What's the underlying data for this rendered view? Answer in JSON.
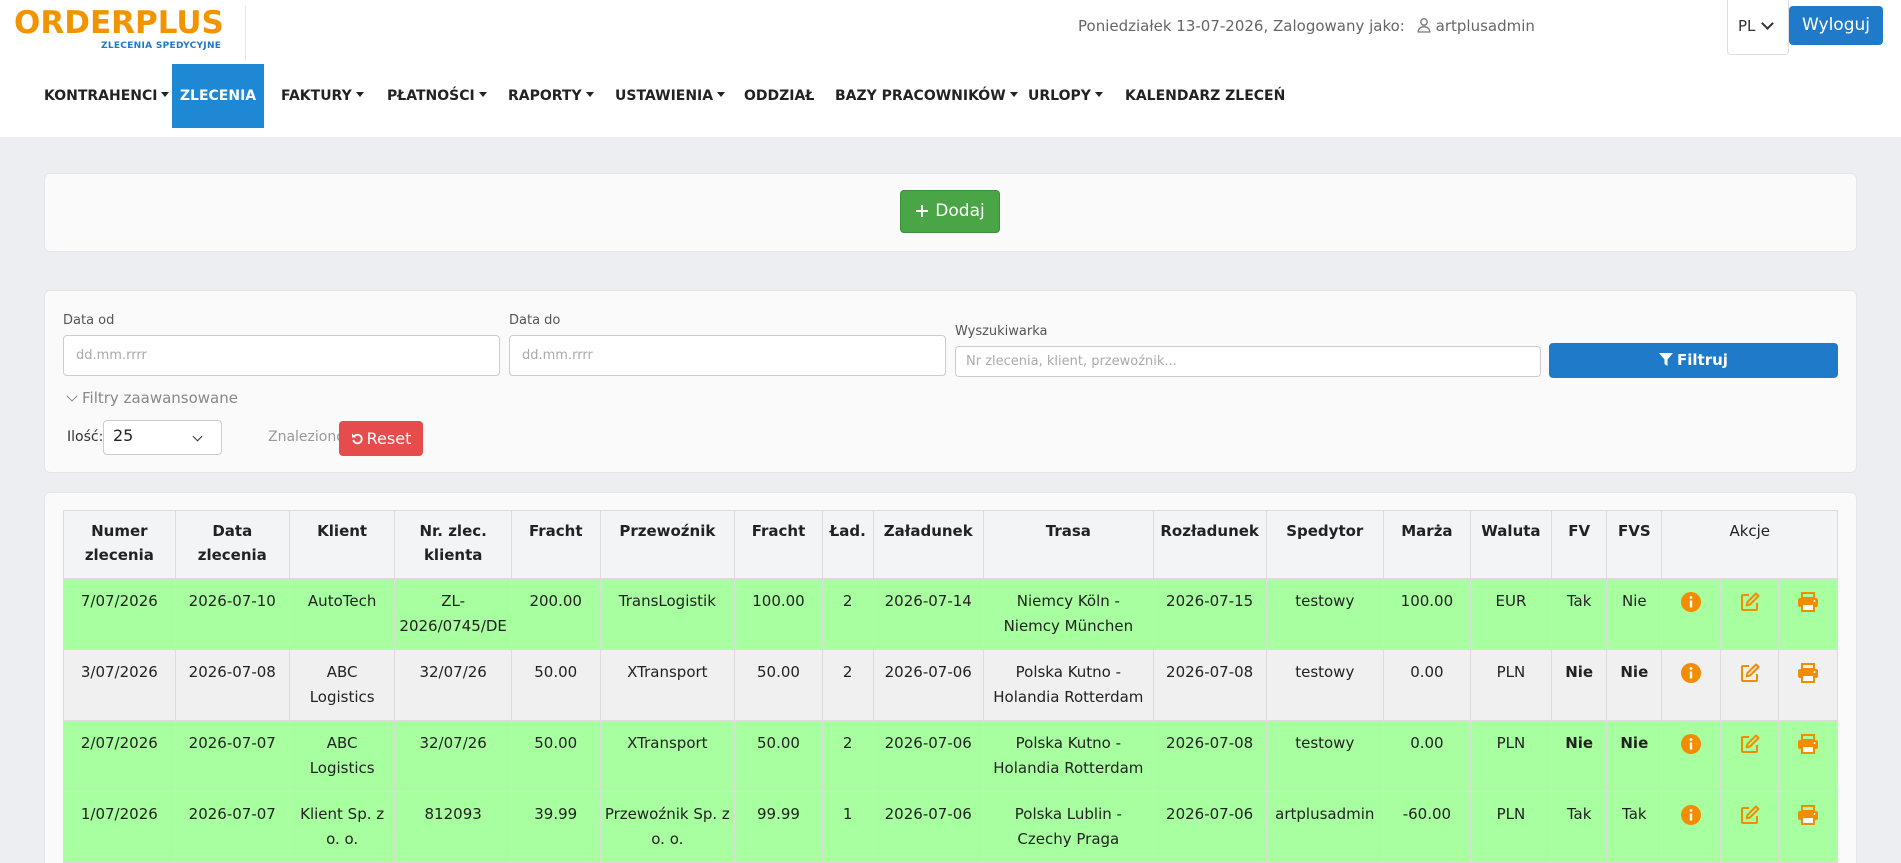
{
  "header": {
    "logo_main": "ORDERPLUS",
    "logo_sub": "ZLECENIA SPEDYCYJNE",
    "date_text": "Poniedziałek 13-07-2026, Zalogowany jako:",
    "username": "artplusadmin",
    "language": "PL",
    "logout_label": "Wyloguj",
    "colors": {
      "logo": "#f29400",
      "primary": "#1f7bc9"
    }
  },
  "nav": {
    "items": [
      {
        "label": "KONTRAHENCI",
        "dropdown": true
      },
      {
        "label": "ZLECENIA",
        "dropdown": false,
        "active": true
      },
      {
        "label": "FAKTURY",
        "dropdown": true
      },
      {
        "label": "PŁATNOŚCI",
        "dropdown": true
      },
      {
        "label": "RAPORTY",
        "dropdown": true
      },
      {
        "label": "USTAWIENIA",
        "dropdown": true
      },
      {
        "label": "ODDZIAŁ",
        "dropdown": false
      },
      {
        "label": "BAZY PRACOWNIKÓW",
        "dropdown": true
      },
      {
        "label": "URLOPY",
        "dropdown": true
      },
      {
        "label": "KALENDARZ ZLECEŃ",
        "dropdown": false
      }
    ]
  },
  "add_panel": {
    "add_label": "Dodaj"
  },
  "filters": {
    "date_from_label": "Data od",
    "date_from_placeholder": "dd.mm.rrrr",
    "date_to_label": "Data do",
    "date_to_placeholder": "dd.mm.rrrr",
    "search_label": "Wyszukiwarka",
    "search_placeholder": "Nr zlecenia, klient, przewoźnik...",
    "filter_label": "Filtruj",
    "advanced_label": "Filtry zaawansowane",
    "qty_label": "Ilość:",
    "qty_value": "25",
    "found_text": "Znaleziono: 4",
    "reset_label": "Reset"
  },
  "table": {
    "headers": [
      "Numer zlecenia",
      "Data zlecenia",
      "Klient",
      "Nr. zlec. klienta",
      "Fracht",
      "Przewoźnik",
      "Fracht",
      "Ład.",
      "Załadunek",
      "Trasa",
      "Rozładunek",
      "Spedytor",
      "Marża",
      "Waluta",
      "FV",
      "FVS",
      "Akcje"
    ],
    "rows": [
      {
        "style": "green",
        "numer": "7/07/2026",
        "data": "2026-07-10",
        "klient": "AutoTech",
        "nr_klienta": "ZL-2026/0745/DE",
        "fracht1": "200.00",
        "przewoznik": "TransLogistik",
        "fracht2": "100.00",
        "lad": "2",
        "zaladunek": "2026-07-14",
        "trasa": "Niemcy Köln - Niemcy München",
        "rozladunek": "2026-07-15",
        "spedytor": "testowy",
        "marza": "100.00",
        "waluta": "EUR",
        "fv": "Tak",
        "fvs": "Nie",
        "fv_style": "tak",
        "fvs_style": "plain"
      },
      {
        "style": "gray",
        "numer": "3/07/2026",
        "data": "2026-07-08",
        "klient": "ABC Logistics",
        "nr_klienta": "32/07/26",
        "fracht1": "50.00",
        "przewoznik": "XTransport",
        "fracht2": "50.00",
        "lad": "2",
        "zaladunek": "2026-07-06",
        "trasa": "Polska Kutno - Holandia Rotterdam",
        "rozladunek": "2026-07-08",
        "spedytor": "testowy",
        "marza": "0.00",
        "waluta": "PLN",
        "fv": "Nie",
        "fvs": "Nie",
        "fv_style": "nie",
        "fvs_style": "nie"
      },
      {
        "style": "green",
        "numer": "2/07/2026",
        "data": "2026-07-07",
        "klient": "ABC Logistics",
        "nr_klienta": "32/07/26",
        "fracht1": "50.00",
        "przewoznik": "XTransport",
        "fracht2": "50.00",
        "lad": "2",
        "zaladunek": "2026-07-06",
        "trasa": "Polska Kutno - Holandia Rotterdam",
        "rozladunek": "2026-07-08",
        "spedytor": "testowy",
        "marza": "0.00",
        "waluta": "PLN",
        "fv": "Nie",
        "fvs": "Nie",
        "fv_style": "nie",
        "fvs_style": "nie"
      },
      {
        "style": "green",
        "numer": "1/07/2026",
        "data": "2026-07-07",
        "klient": "Klient Sp. z o. o.",
        "nr_klienta": "812093",
        "fracht1": "39.99",
        "przewoznik": "Przewoźnik Sp. z o. o.",
        "fracht2": "99.99",
        "lad": "1",
        "zaladunek": "2026-07-06",
        "trasa": "Polska Lublin - Czechy Praga",
        "rozladunek": "2026-07-06",
        "spedytor": "artplusadmin",
        "marza": "-60.00",
        "waluta": "PLN",
        "fv": "Tak",
        "fvs": "Tak",
        "fv_style": "tak",
        "fvs_style": "tak"
      }
    ],
    "action_icons": [
      "info-icon",
      "edit-icon",
      "print-icon"
    ],
    "colors": {
      "row_green": "#a8ff9f",
      "row_gray": "#f0f0f0",
      "action": "#f28c00",
      "nie": "#e00000",
      "link": "#2a8ad8"
    }
  }
}
